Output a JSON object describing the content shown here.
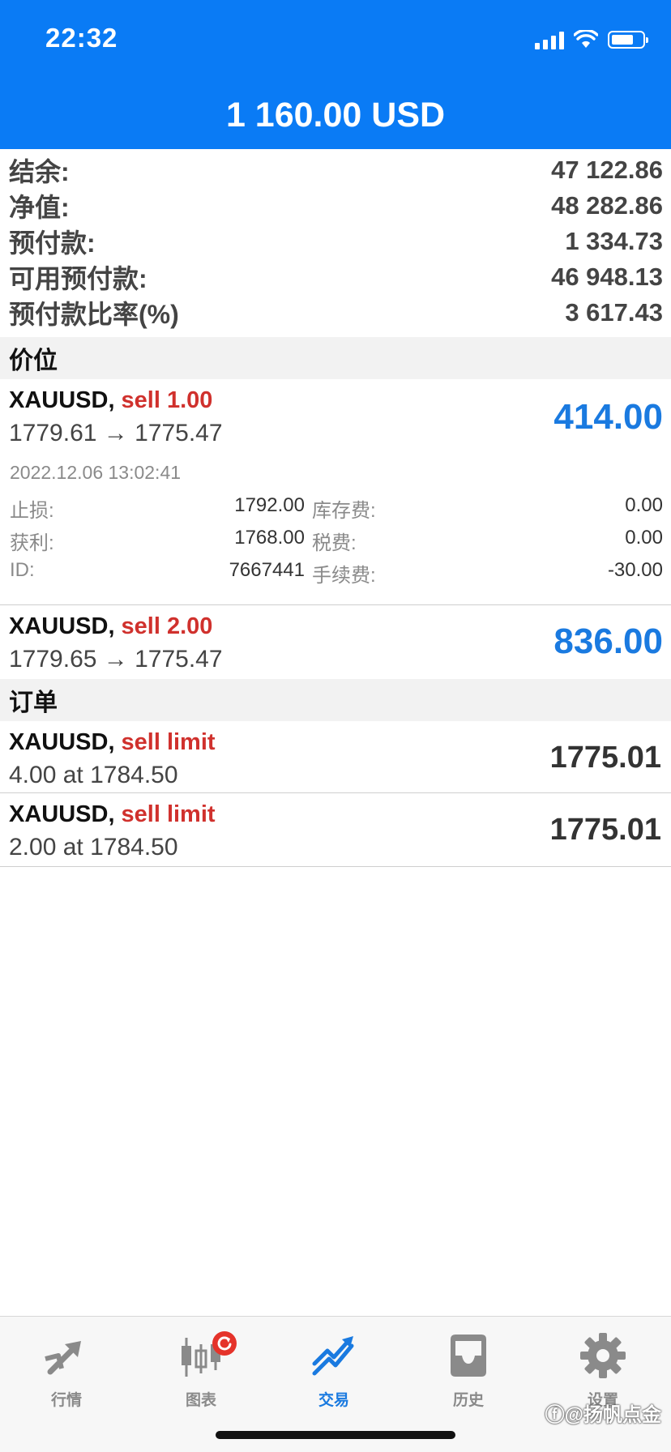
{
  "status_bar": {
    "time": "22:32"
  },
  "header": {
    "title": "1 160.00 USD"
  },
  "summary": [
    {
      "label": "结余:",
      "value": "47 122.86"
    },
    {
      "label": "净值:",
      "value": "48 282.86"
    },
    {
      "label": "预付款:",
      "value": "1 334.73"
    },
    {
      "label": "可用预付款:",
      "value": "46 948.13"
    },
    {
      "label": "预付款比率(%)",
      "value": "3 617.43"
    }
  ],
  "positions_section": {
    "title": "价位"
  },
  "positions": [
    {
      "symbol": "XAUUSD,",
      "side": "sell 1.00",
      "prices": "1779.61 → 1775.47",
      "profit": "414.00",
      "time": "2022.12.06 13:02:41",
      "details": [
        {
          "k1": "止损:",
          "v1": "1792.00",
          "k2": "库存费:",
          "v2": "0.00"
        },
        {
          "k1": "获利:",
          "v1": "1768.00",
          "k2": "税费:",
          "v2": "0.00"
        },
        {
          "k1": "ID:",
          "v1": "7667441",
          "k2": "手续费:",
          "v2": "-30.00"
        }
      ]
    },
    {
      "symbol": "XAUUSD,",
      "side": "sell 2.00",
      "prices": "1779.65 → 1775.47",
      "profit": "836.00"
    }
  ],
  "orders_section": {
    "title": "订单"
  },
  "orders": [
    {
      "symbol": "XAUUSD,",
      "side": "sell limit",
      "details": "4.00 at 1784.50",
      "price": "1775.01"
    },
    {
      "symbol": "XAUUSD,",
      "side": "sell limit",
      "details": "2.00 at 1784.50",
      "price": "1775.01"
    }
  ],
  "tabbar": {
    "items": [
      {
        "label": "行情",
        "icon": "quotes-arrows-icon"
      },
      {
        "label": "图表",
        "icon": "candlestick-chart-icon",
        "badge_icon": "refresh-icon"
      },
      {
        "label": "交易",
        "icon": "trade-chart-icon",
        "active": true
      },
      {
        "label": "历史",
        "icon": "inbox-tray-icon"
      },
      {
        "label": "设置",
        "icon": "gear-icon"
      }
    ]
  },
  "watermark": "ⓕ@扬帆点金",
  "colors": {
    "header_bg": "#0a7bf5",
    "profit_blue": "#1a7ae0",
    "sell_red": "#d0312d",
    "badge_red": "#e5332a"
  }
}
